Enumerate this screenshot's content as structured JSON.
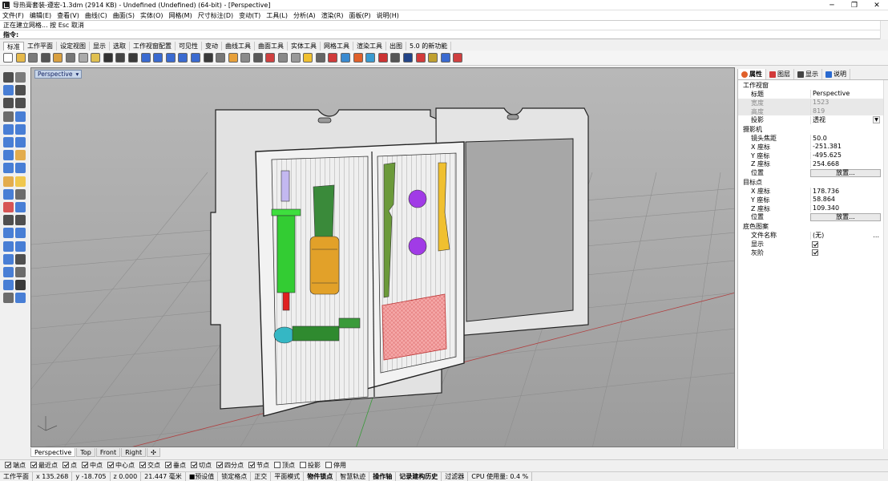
{
  "window": {
    "title": "导热膏套装-遵宏-1.3dm (2914 KB) - Undefined (Undefined) (64-bit) - [Perspective]",
    "minimize": "─",
    "restore": "❐",
    "close": "✕"
  },
  "menu": [
    "文件(F)",
    "编辑(E)",
    "查看(V)",
    "曲线(C)",
    "曲面(S)",
    "实体(O)",
    "网格(M)",
    "尺寸标注(D)",
    "变动(T)",
    "工具(L)",
    "分析(A)",
    "渲染(R)",
    "面板(P)",
    "说明(H)"
  ],
  "command": {
    "history": "正在建立网格... 按 Esc 取消",
    "prompt": "指令:"
  },
  "tabs": [
    "标准",
    "工作平面",
    "设定视图",
    "显示",
    "选取",
    "工作视窗配置",
    "可见性",
    "变动",
    "曲线工具",
    "曲面工具",
    "实体工具",
    "网格工具",
    "渲染工具",
    "出图",
    "5.0 的新功能"
  ],
  "toolbar_icons": [
    "new-file-icon",
    "open-icon",
    "save-icon",
    "print-icon",
    "import-icon",
    "cut-icon",
    "copy-icon",
    "paste-icon",
    "undo-icon",
    "pan-icon",
    "rotate-view-icon",
    "zoom-icon",
    "zoom-window-icon",
    "zoom-extents-icon",
    "zoom-selected-icon",
    "zoom-all-icon",
    "four-viewports-icon",
    "cplane-icon",
    "layer-icon",
    "properties-icon",
    "select-icon",
    "snap-icon",
    "point-icon",
    "curve-icon",
    "light-icon",
    "lock-icon",
    "hide-icon",
    "show-icon",
    "material-icon",
    "render-color-icon",
    "render-sphere-icon",
    "shade-sphere-icon",
    "rendered-icon",
    "texture-icon",
    "settings-gear-icon",
    "help-icon",
    "options-icon"
  ],
  "left_tools": [
    "select-arrow-icon",
    "point-icon",
    "polyline-icon",
    "curve-tool-icon",
    "circle-icon",
    "arc-icon",
    "rectangle-icon",
    "ellipse-icon",
    "polygon-icon",
    "freeform-icon",
    "surface-icon",
    "extrude-icon",
    "box-icon",
    "sphere-icon",
    "cylinder-icon",
    "loft-icon",
    "boolean-icon",
    "fillet-icon",
    "mesh-icon",
    "shell-icon",
    "explode-icon",
    "join-icon",
    "trim-icon",
    "split-icon",
    "text-icon",
    "dimension-icon",
    "move-icon",
    "copy-tool-icon",
    "rotate-tool-icon",
    "scale-icon",
    "array-icon",
    "mirror-icon",
    "analyze-icon",
    "check-icon",
    "render-tool-icon",
    "group-icon"
  ],
  "viewport": {
    "label": "Perspective",
    "arrow": "▾"
  },
  "view_tabs": [
    "Perspective",
    "Top",
    "Front",
    "Right",
    "✣"
  ],
  "osnaps": [
    {
      "label": "端点",
      "on": true
    },
    {
      "label": "最近点",
      "on": true
    },
    {
      "label": "点",
      "on": true
    },
    {
      "label": "中点",
      "on": true
    },
    {
      "label": "中心点",
      "on": true
    },
    {
      "label": "交点",
      "on": true
    },
    {
      "label": "垂点",
      "on": true
    },
    {
      "label": "切点",
      "on": true
    },
    {
      "label": "四分点",
      "on": true
    },
    {
      "label": "节点",
      "on": true
    },
    {
      "label": "顶点",
      "on": false
    },
    {
      "label": "投影",
      "on": false
    },
    {
      "label": "停用",
      "on": false
    }
  ],
  "status": [
    "工作平面",
    "x 135.268",
    "y -18.705",
    "z 0.000",
    "21.447 毫米",
    "■预设值",
    "锁定格点",
    "正交",
    "平面模式",
    "物件锁点",
    "智慧轨迹",
    "操作轴",
    "记录建构历史",
    "过滤器",
    "CPU 使用量: 0.4 %"
  ],
  "panel": {
    "tabs": [
      "属性",
      "图层",
      "显示",
      "说明"
    ],
    "section_viewport": "工作视窗",
    "title_k": "标题",
    "title_v": "Perspective",
    "width_k": "宽度",
    "width_v": "1523",
    "height_k": "高度",
    "height_v": "819",
    "proj_k": "投影",
    "proj_v": "透视",
    "section_camera": "摄影机",
    "lens_k": "镜头焦距",
    "lens_v": "50.0",
    "cx_k": "X 座标",
    "cx_v": "-251.381",
    "cy_k": "Y 座标",
    "cy_v": "-495.625",
    "cz_k": "Z 座标",
    "cz_v": "254.668",
    "pos_k": "位置",
    "place_btn": "放置...",
    "section_target": "目标点",
    "tx_k": "X 座标",
    "tx_v": "178.736",
    "ty_k": "Y 座标",
    "ty_v": "58.864",
    "tz_k": "Z 座标",
    "tz_v": "109.340",
    "tpos_k": "位置",
    "tplace_btn": "放置...",
    "section_bg": "底色图案",
    "file_k": "文件名称",
    "file_v": "(无)",
    "file_btn": "...",
    "show_k": "显示",
    "gray_k": "灰阶"
  }
}
